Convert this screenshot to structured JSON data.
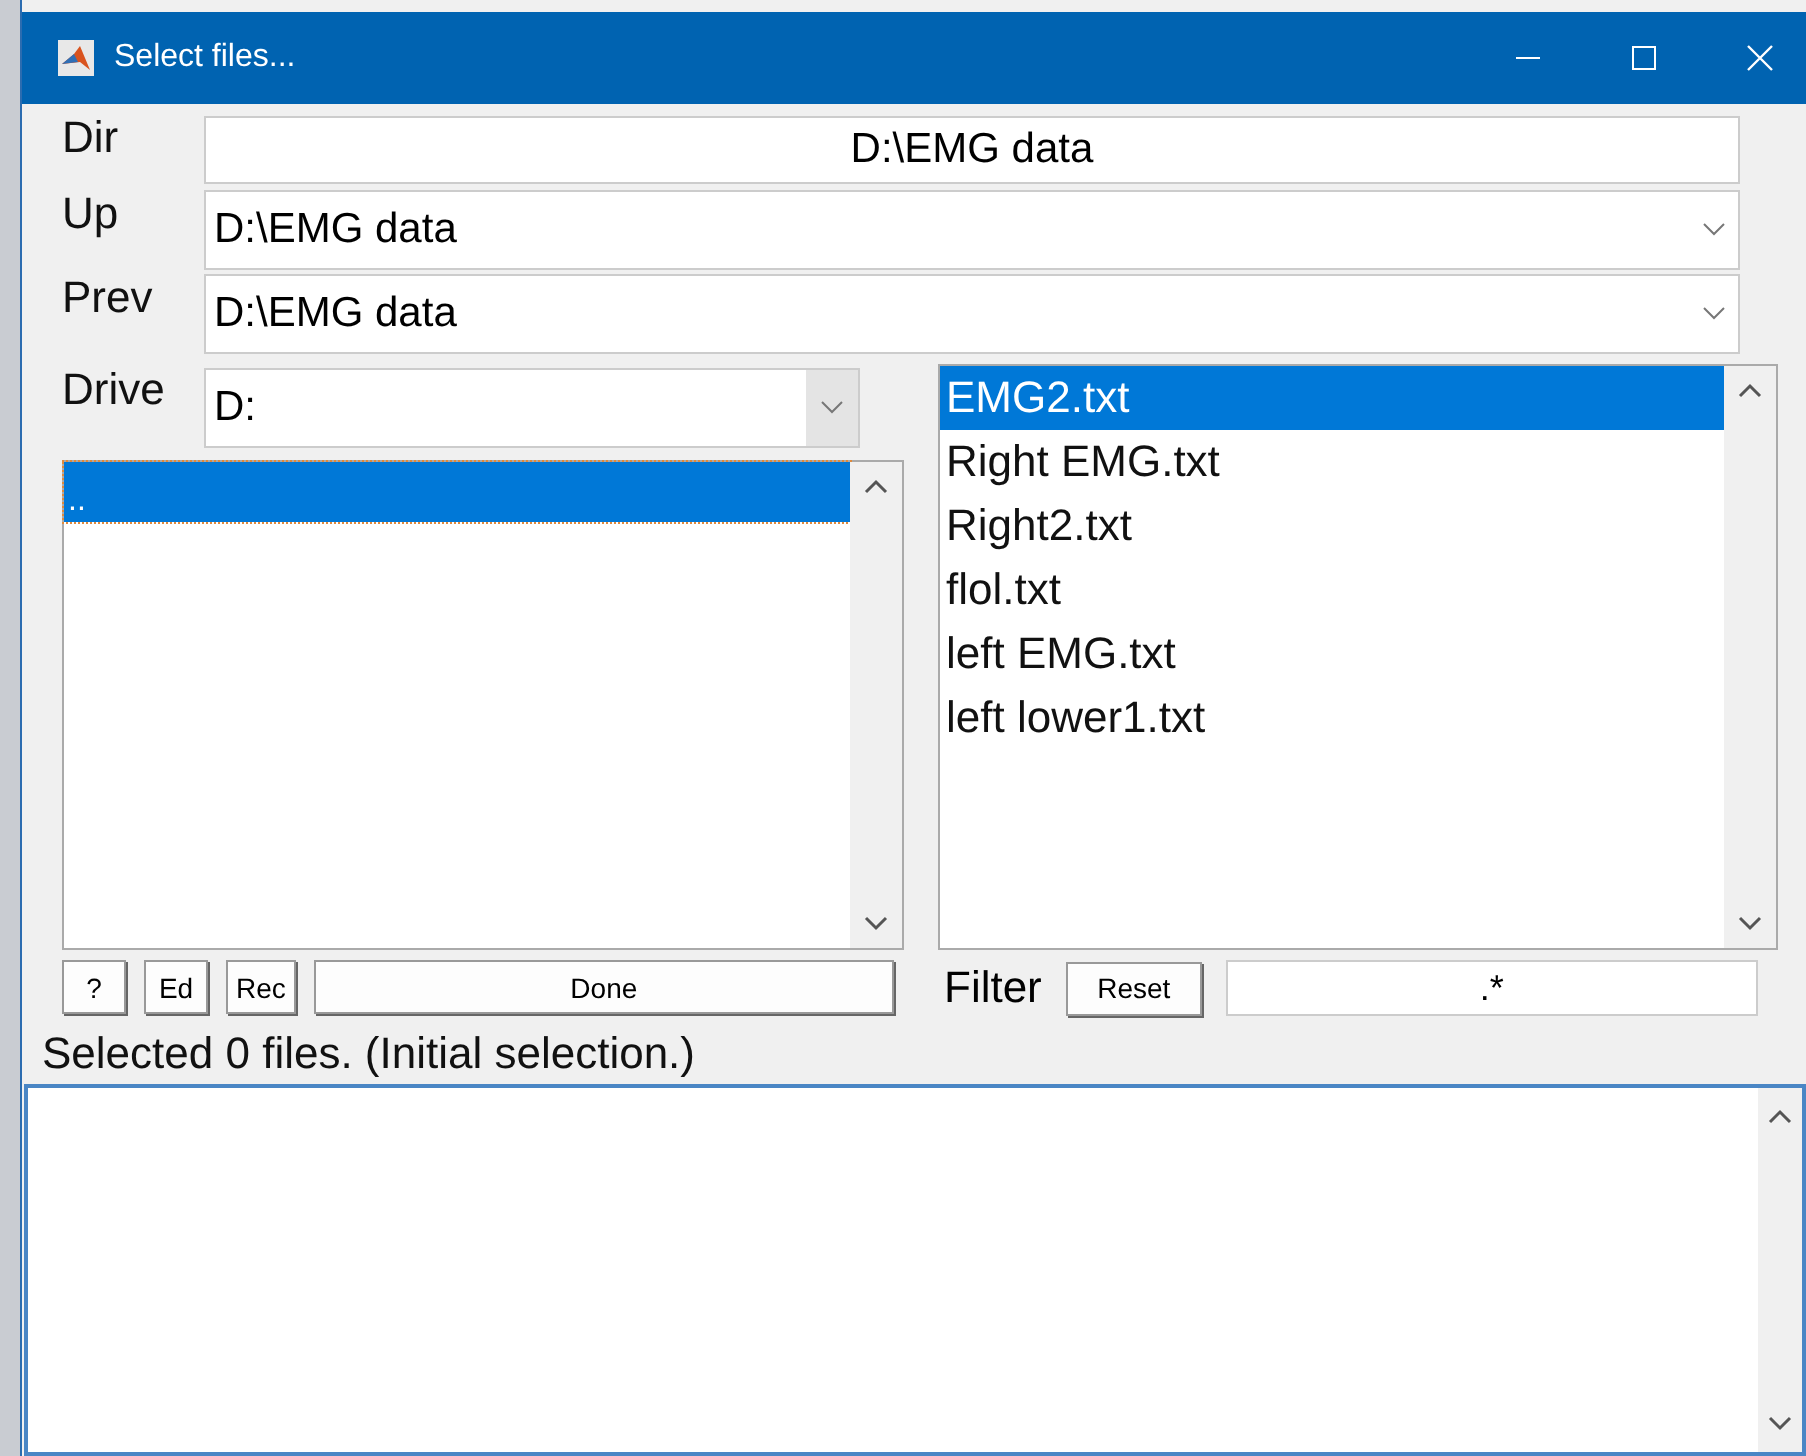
{
  "window": {
    "title": "Select files..."
  },
  "fields": {
    "dir": {
      "label": "Dir",
      "value": "D:\\EMG data"
    },
    "up": {
      "label": "Up",
      "value": "D:\\EMG data"
    },
    "prev": {
      "label": "Prev",
      "value": "D:\\EMG data"
    },
    "drive": {
      "label": "Drive",
      "value": "D:"
    }
  },
  "dir_list": [
    {
      "name": "..",
      "selected": true
    }
  ],
  "file_list": [
    {
      "name": "EMG2.txt",
      "selected": true
    },
    {
      "name": "Right EMG.txt",
      "selected": false
    },
    {
      "name": "Right2.txt",
      "selected": false
    },
    {
      "name": "flol.txt",
      "selected": false
    },
    {
      "name": "left EMG.txt",
      "selected": false
    },
    {
      "name": "left lower1.txt",
      "selected": false
    }
  ],
  "buttons": [
    "?",
    "Ed",
    "Rec",
    "Done"
  ],
  "filter": {
    "label": "Filter",
    "reset": "Reset",
    "value": ".*"
  },
  "status": "Selected 0 files. (Initial selection.)"
}
